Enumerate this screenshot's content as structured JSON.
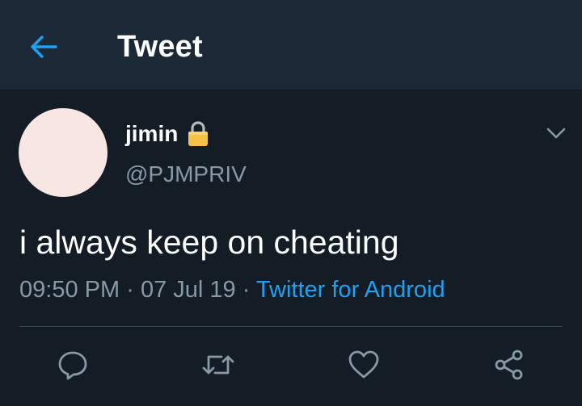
{
  "header": {
    "title": "Tweet",
    "back_icon": "arrow-left-icon"
  },
  "tweet": {
    "avatar_color": "#f7e6e1",
    "display_name": "jimin",
    "protected_icon": "lock-icon",
    "handle": "@PJMPRIV",
    "menu_icon": "chevron-down-icon",
    "text": "i always keep on cheating",
    "time": "09:50 PM",
    "separator": "·",
    "date": "07 Jul 19",
    "source": "Twitter for Android"
  },
  "actions": [
    {
      "name": "reply",
      "icon": "reply-icon"
    },
    {
      "name": "retweet",
      "icon": "retweet-icon"
    },
    {
      "name": "like",
      "icon": "heart-icon"
    },
    {
      "name": "share",
      "icon": "share-icon"
    }
  ],
  "colors": {
    "background": "#141d26",
    "header_background": "#1b2836",
    "accent": "#1da1f2",
    "secondary_text": "#8899a6",
    "icon": "#8899a6"
  }
}
